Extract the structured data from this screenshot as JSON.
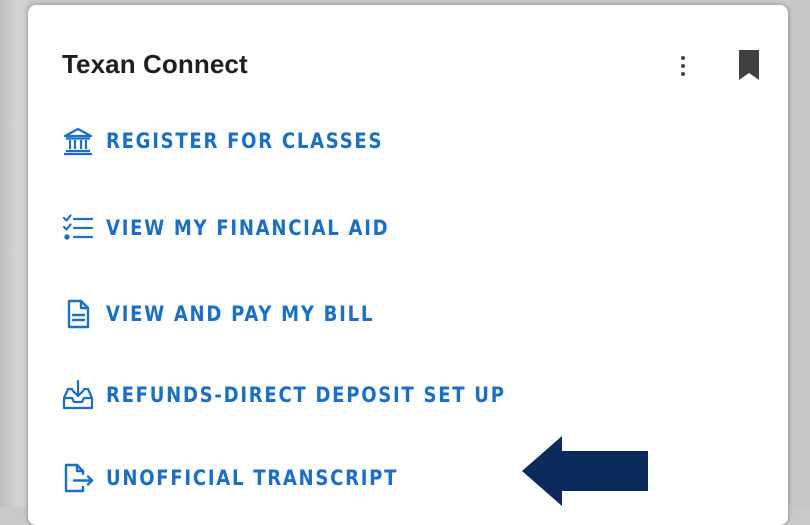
{
  "card": {
    "title": "Texan Connect"
  },
  "links": [
    {
      "label": "REGISTER FOR CLASSES",
      "icon": "bank-icon"
    },
    {
      "label": "VIEW MY FINANCIAL AID",
      "icon": "checklist-icon"
    },
    {
      "label": "VIEW AND PAY MY BILL",
      "icon": "document-icon"
    },
    {
      "label": "REFUNDS-DIRECT DEPOSIT SET UP",
      "icon": "inbox-download-icon"
    },
    {
      "label": "UNOFFICIAL TRANSCRIPT",
      "icon": "export-file-icon"
    }
  ],
  "colors": {
    "link": "#1a6fc6",
    "arrow": "#0d2a5c",
    "title": "#1f1f1f"
  }
}
